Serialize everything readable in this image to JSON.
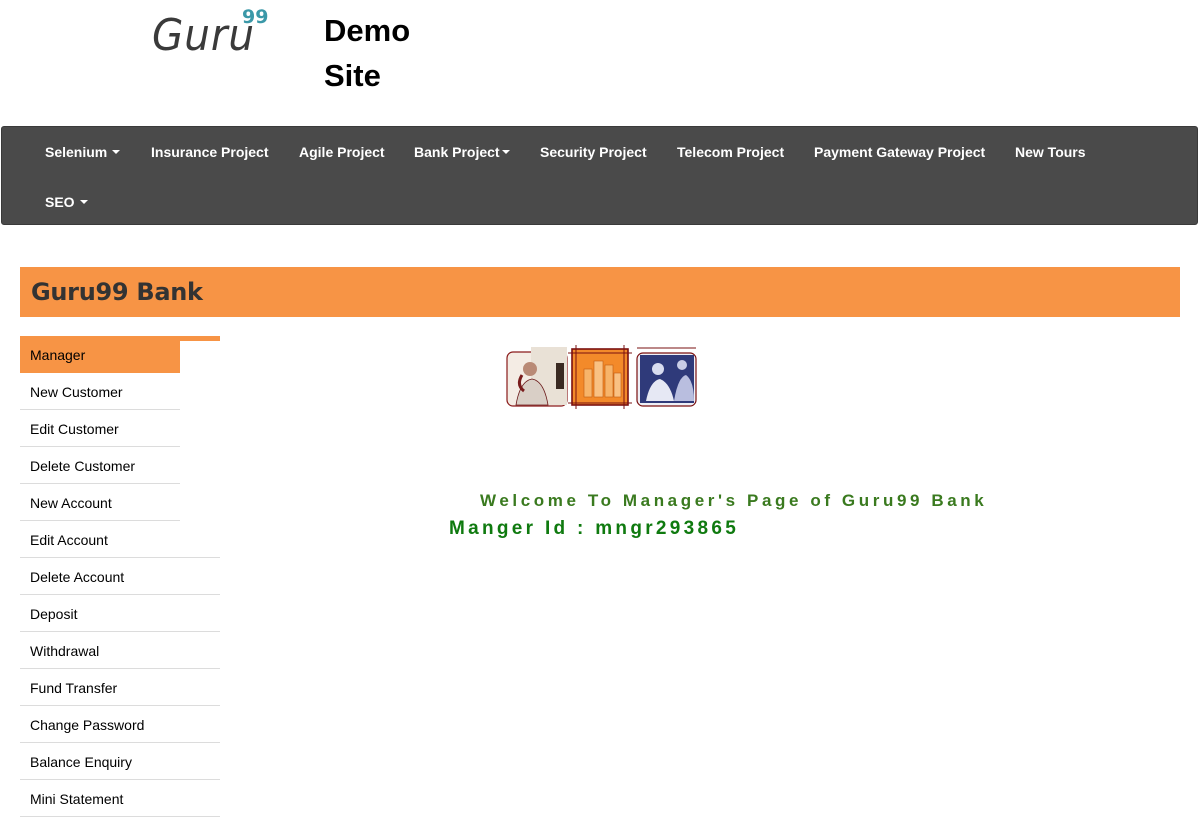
{
  "header": {
    "logo_word": "Guru",
    "logo_sup": "99",
    "site_title_line1": "Demo",
    "site_title_line2": "Site"
  },
  "navbar": {
    "items": [
      {
        "label": "Selenium",
        "dropdown": true
      },
      {
        "label": "Insurance Project",
        "dropdown": false
      },
      {
        "label": "Agile Project",
        "dropdown": false
      },
      {
        "label": "Bank Project",
        "dropdown": true
      },
      {
        "label": "Security Project",
        "dropdown": false
      },
      {
        "label": "Telecom Project",
        "dropdown": false
      },
      {
        "label": "Payment Gateway Project",
        "dropdown": false
      },
      {
        "label": "New Tours",
        "dropdown": false
      },
      {
        "label": "SEO",
        "dropdown": true
      }
    ]
  },
  "bank": {
    "title": "Guru99 Bank"
  },
  "sidebar": {
    "items": [
      {
        "label": "Manager",
        "active": true
      },
      {
        "label": "New Customer"
      },
      {
        "label": "Edit Customer"
      },
      {
        "label": "Delete Customer"
      },
      {
        "label": "New Account"
      },
      {
        "label": "Edit Account"
      },
      {
        "label": "Delete Account"
      },
      {
        "label": "Deposit"
      },
      {
        "label": "Withdrawal"
      },
      {
        "label": "Fund Transfer"
      },
      {
        "label": "Change Password"
      },
      {
        "label": "Balance Enquiry"
      },
      {
        "label": "Mini Statement"
      }
    ]
  },
  "main": {
    "welcome_text": "Welcome To Manager's Page of Guru99 Bank",
    "manager_id_text": "Manger Id : mngr293865"
  },
  "colors": {
    "accent": "#f79445",
    "navbar": "#4a4a4a",
    "welcome_green": "#3a7a1f",
    "id_green": "#0f7a0f",
    "logo_teal": "#3b98a8"
  }
}
